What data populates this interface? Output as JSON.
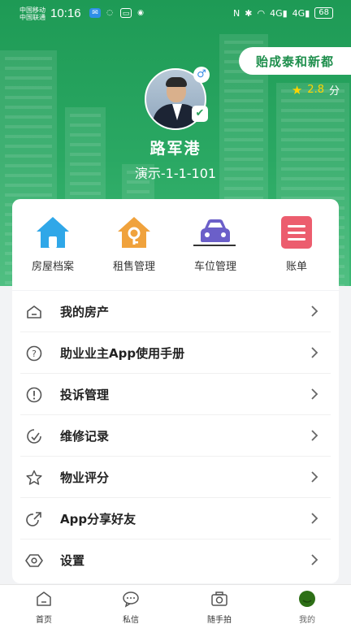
{
  "status_bar": {
    "carrier1": "中国移动",
    "carrier2": "中国联通",
    "time": "10:16",
    "signal1": "4G",
    "signal2": "4G",
    "battery": "68"
  },
  "header": {
    "community": "贻成泰和新都",
    "rating": "2.8",
    "rating_unit": "分",
    "user_name": "路军港",
    "room": "演示-1-1-101"
  },
  "quick_actions": [
    {
      "label": "房屋档案",
      "icon": "house-icon"
    },
    {
      "label": "租售管理",
      "icon": "key-house-icon"
    },
    {
      "label": "车位管理",
      "icon": "car-icon"
    },
    {
      "label": "账单",
      "icon": "bill-icon"
    }
  ],
  "menu": [
    {
      "label": "我的房产",
      "icon": "home-outline-icon"
    },
    {
      "label": "助业业主App使用手册",
      "icon": "help-circle-icon"
    },
    {
      "label": "投诉管理",
      "icon": "alert-circle-icon"
    },
    {
      "label": "维修记录",
      "icon": "wrench-icon"
    },
    {
      "label": "物业评分",
      "icon": "star-outline-icon"
    },
    {
      "label": "App分享好友",
      "icon": "share-icon"
    },
    {
      "label": "设置",
      "icon": "settings-icon"
    }
  ],
  "tabbar": [
    {
      "label": "首页",
      "icon": "home-tab-icon"
    },
    {
      "label": "私信",
      "icon": "message-tab-icon"
    },
    {
      "label": "随手拍",
      "icon": "camera-tab-icon"
    },
    {
      "label": "我的",
      "icon": "profile-tab-icon"
    }
  ],
  "colors": {
    "brand_green": "#2aa863",
    "accent_yellow": "#ffd400"
  }
}
